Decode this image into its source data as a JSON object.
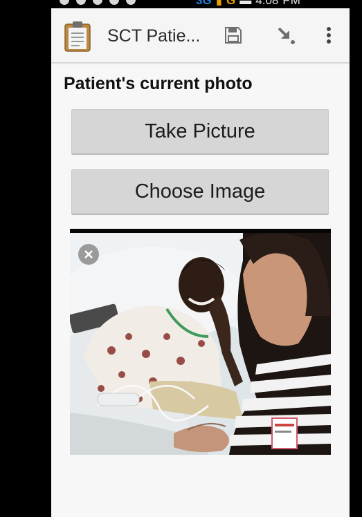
{
  "statusbar": {
    "network": "3G",
    "carrier": "G",
    "time": "4:08",
    "ampm": "PM"
  },
  "app": {
    "title": "SCT Patie..."
  },
  "section": {
    "label": "Patient's current photo"
  },
  "buttons": {
    "take_picture": "Take Picture",
    "choose_image": "Choose Image"
  },
  "icons": {
    "app": "clipboard-icon",
    "save": "floppy-disk-icon",
    "next": "arrow-down-right-icon",
    "more": "overflow-menu-icon",
    "remove": "close-icon"
  },
  "colors": {
    "screen_bg": "#f7f7f7",
    "button_bg": "#d6d6d6",
    "network_blue": "#1e7fe0",
    "signal_orange": "#e8a000"
  }
}
